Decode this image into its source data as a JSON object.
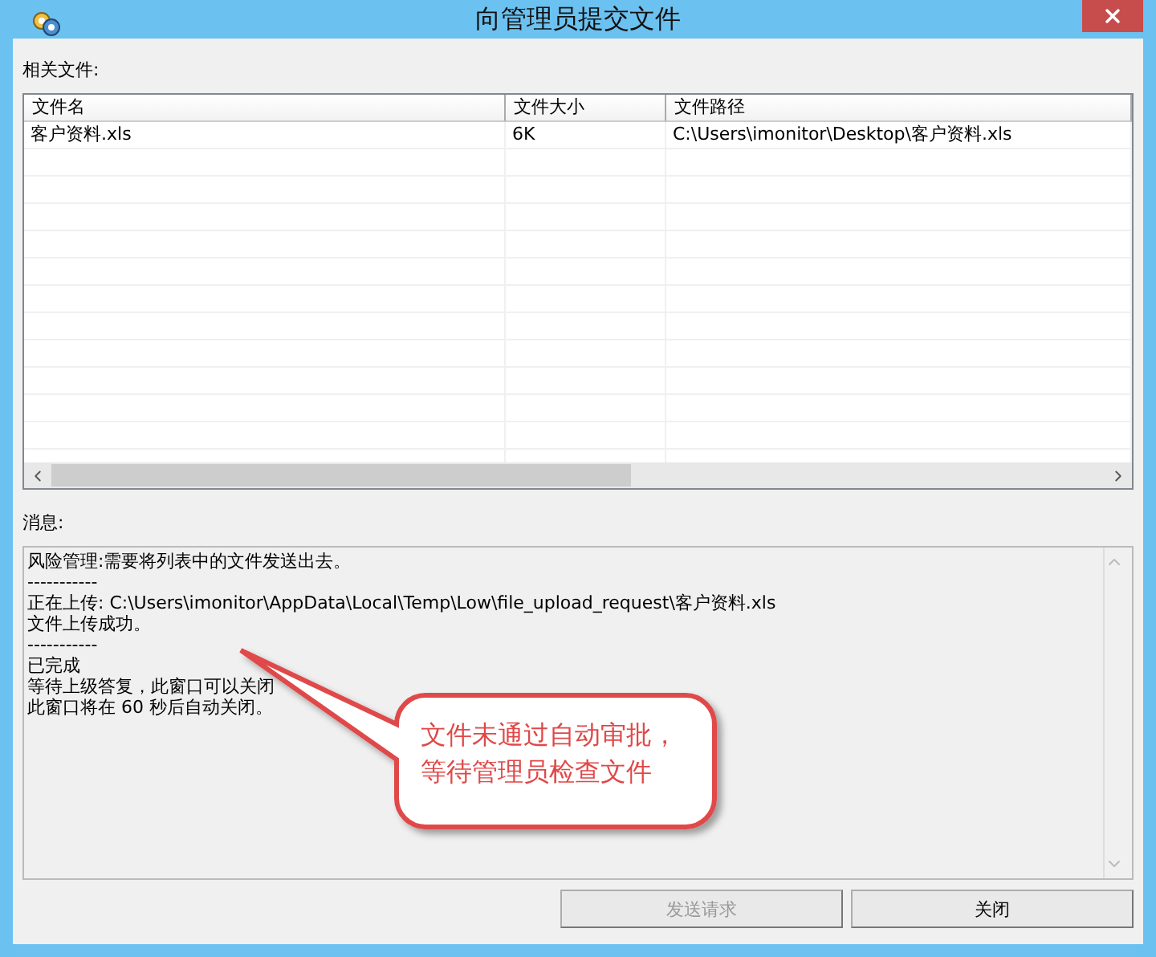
{
  "window": {
    "title": "向管理员提交文件"
  },
  "files_label": "相关文件:",
  "file_table": {
    "columns": [
      "文件名",
      "文件大小",
      "文件路径"
    ],
    "rows": [
      [
        "客户资料.xls",
        "6K",
        "C:\\Users\\imonitor\\Desktop\\客户资料.xls"
      ]
    ]
  },
  "messages_label": "消息:",
  "messages": [
    "风险管理:需要将列表中的文件发送出去。",
    "-----------",
    "正在上传: C:\\Users\\imonitor\\AppData\\Local\\Temp\\Low\\file_upload_request\\客户资料.xls",
    "文件上传成功。",
    "-----------",
    "已完成",
    "等待上级答复，此窗口可以关闭",
    "此窗口将在 60 秒后自动关闭。"
  ],
  "callout": {
    "lines": [
      "文件未通过自动审批，",
      "等待管理员检查文件"
    ]
  },
  "buttons": [
    {
      "label": "发送请求",
      "disabled": true
    },
    {
      "label": "关闭",
      "disabled": false
    }
  ]
}
